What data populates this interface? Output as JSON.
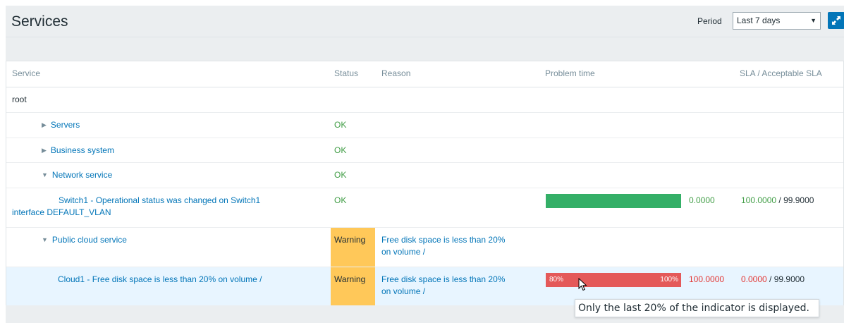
{
  "header": {
    "title": "Services",
    "period_label": "Period",
    "period_value": "Last 7 days",
    "fullscreen_icon": "fullscreen-icon"
  },
  "table": {
    "columns": {
      "service": "Service",
      "status": "Status",
      "reason": "Reason",
      "problem_time": "Problem time",
      "sla": "SLA / Acceptable SLA"
    },
    "rows": [
      {
        "service": "root",
        "status": "",
        "reason": ""
      },
      {
        "service": "Servers",
        "expander": "collapsed",
        "status": "OK"
      },
      {
        "service": "Business system",
        "expander": "collapsed",
        "status": "OK"
      },
      {
        "service": "Network service",
        "expander": "expanded",
        "status": "OK"
      },
      {
        "service_name": "Switch1",
        "service_rest_line1": " - Operational status was changed on Switch1",
        "service_rest_line2": "interface DEFAULT_VLAN",
        "status": "OK",
        "problem_time_value": "0.0000",
        "sla_value": "100.0000",
        "sla_separator": " / ",
        "sla_acceptable": "99.9000",
        "bar_color": "#34af67"
      },
      {
        "service": "Public cloud service",
        "expander": "expanded",
        "status": "Warning",
        "reason_line1": "Free disk space is less than 20%",
        "reason_line2": "on volume /"
      },
      {
        "service_name": "Cloud1",
        "service_rest": " - Free disk space is less than 20% on volume /",
        "status": "Warning",
        "reason_line1": "Free disk space is less than 20%",
        "reason_line2": "on volume /",
        "bar_start_label": "80%",
        "bar_end_label": "100%",
        "problem_time_value": "100.0000",
        "sla_value": "0.0000",
        "sla_separator": " / ",
        "sla_acceptable": "99.9000",
        "bar_color": "#e45959"
      }
    ]
  },
  "tooltip": {
    "text": "Only the last 20% of the indicator is displayed."
  },
  "colors": {
    "accent": "#0275b8",
    "ok": "#429e47",
    "problem": "#e33734",
    "warning_bg": "#ffc859",
    "row_highlight": "#e8f5ff"
  }
}
